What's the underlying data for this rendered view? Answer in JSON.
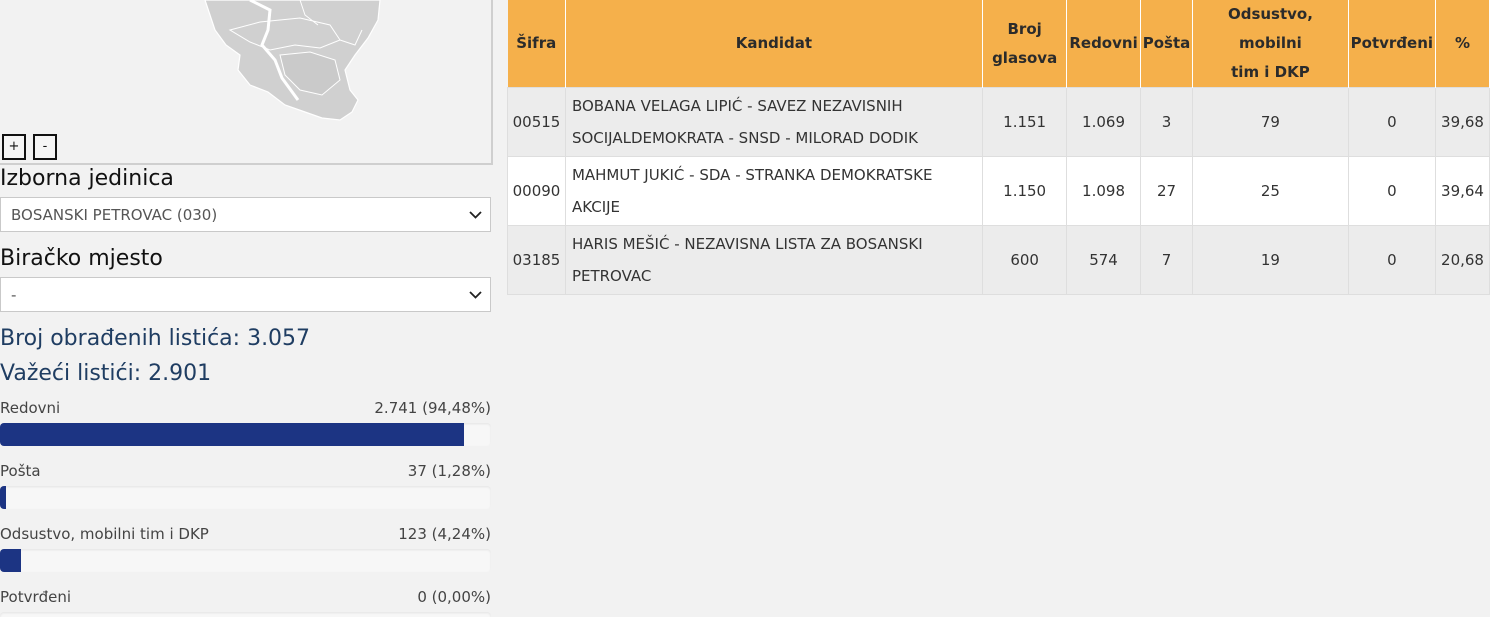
{
  "map": {
    "zoom_in_label": "+",
    "zoom_out_label": "-"
  },
  "filters": {
    "unit_label": "Izborna jedinica",
    "unit_value": "BOSANSKI PETROVAC (030)",
    "station_label": "Biračko mjesto",
    "station_value": "-"
  },
  "stats": {
    "processed": "Broj obrađenih listića: 3.057",
    "valid": "Važeći listići: 2.901"
  },
  "bars": [
    {
      "label": "Redovni",
      "value": "2.741 (94,48%)",
      "percent": 94.48
    },
    {
      "label": "Pošta",
      "value": "37 (1,28%)",
      "percent": 1.28
    },
    {
      "label": "Odsustvo, mobilni tim i DKP",
      "value": "123 (4,24%)",
      "percent": 4.24
    },
    {
      "label": "Potvrđeni",
      "value": "0 (0,00%)",
      "percent": 0
    }
  ],
  "table": {
    "headers": {
      "code": "Šifra",
      "candidate": "Kandidat",
      "votes_line1": "Broj",
      "votes_line2": "glasova",
      "regular": "Redovni",
      "mail": "Pošta",
      "absent_line1": "Odsustvo, mobilni",
      "absent_line2": "tim i DKP",
      "confirmed": "Potvrđeni",
      "percent": "%"
    },
    "rows": [
      {
        "code": "00515",
        "name_line1": "BOBANA VELAGA LIPIĆ - SAVEZ NEZAVISNIH",
        "name_line2": "SOCIJALDEMOKRATA - SNSD - MILORAD DODIK",
        "votes": "1.151",
        "regular": "1.069",
        "mail": "3",
        "absent": "79",
        "confirmed": "0",
        "percent": "39,68"
      },
      {
        "code": "00090",
        "name_line1": "MAHMUT JUKIĆ - SDA - STRANKA DEMOKRATSKE",
        "name_line2": "AKCIJE",
        "votes": "1.150",
        "regular": "1.098",
        "mail": "27",
        "absent": "25",
        "confirmed": "0",
        "percent": "39,64"
      },
      {
        "code": "03185",
        "name_line1": "HARIS MEŠIĆ - NEZAVISNA LISTA ZA BOSANSKI",
        "name_line2": "PETROVAC",
        "votes": "600",
        "regular": "574",
        "mail": "7",
        "absent": "19",
        "confirmed": "0",
        "percent": "20,68"
      }
    ]
  },
  "colors": {
    "header_bg": "#f5b04b",
    "bar_fill": "#1c3483",
    "stat_text": "#1f3d62"
  }
}
